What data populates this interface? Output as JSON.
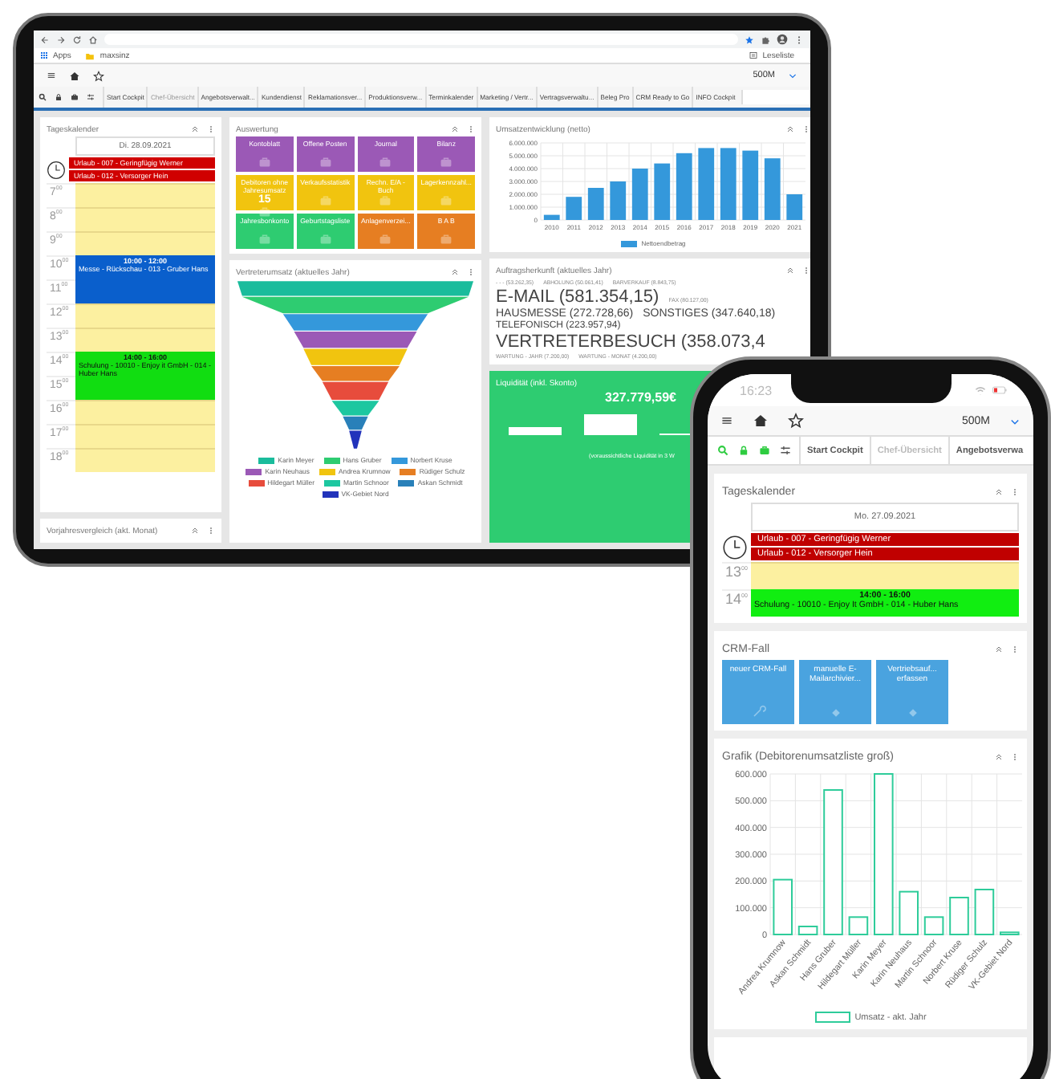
{
  "tablet": {
    "browser": {
      "bookmarks": [
        "Apps",
        "maxsinz"
      ],
      "reading_list": "Leseliste"
    },
    "header": {
      "company": "500M"
    },
    "tabs": [
      {
        "label": "Start Cockpit",
        "disabled": false
      },
      {
        "label": "Chef-Übersicht",
        "disabled": true
      },
      {
        "label": "Angebotsverwalt...",
        "disabled": false
      },
      {
        "label": "Kundendienst",
        "disabled": false
      },
      {
        "label": "Reklamationsver...",
        "disabled": false
      },
      {
        "label": "Produktionsverw...",
        "disabled": false
      },
      {
        "label": "Terminkalender",
        "disabled": false
      },
      {
        "label": "Marketing / Vertr...",
        "disabled": false
      },
      {
        "label": "Vertragsverwaltu...",
        "disabled": false
      },
      {
        "label": "Beleg Pro",
        "disabled": false
      },
      {
        "label": "CRM Ready to Go",
        "disabled": false
      },
      {
        "label": "INFO Cockpit",
        "disabled": false
      }
    ],
    "calendar": {
      "title": "Tageskalender",
      "date": "Di. 28.09.2021",
      "all_day": [
        {
          "title": "Urlaub - 007 - Geringfügig Werner",
          "color": "#d00000"
        },
        {
          "title": "Urlaub - 012 - Versorger Hein",
          "color": "#d00000"
        }
      ],
      "hours": [
        {
          "label": "7$^{00}$",
          "kind": "free"
        },
        {
          "label": "8$^{00}$",
          "kind": "free"
        },
        {
          "label": "9$^{00}$",
          "kind": "free"
        },
        {
          "label": "10$^{00}$",
          "kind": "event",
          "event": {
            "time": "10:00 - 12:00",
            "title": "Messe - Rückschau - 013 - Gruber Hans",
            "color": "#0a5fcc"
          }
        },
        {
          "label": "11$^{00}$",
          "kind": "continued"
        },
        {
          "label": "12$^{00}$",
          "kind": "free"
        },
        {
          "label": "13$^{00}$",
          "kind": "free"
        },
        {
          "label": "14$^{00}$",
          "kind": "event",
          "event": {
            "time": "14:00 - 16:00",
            "title": "Schulung - 10010 - Enjoy it GmbH - 014 - Huber Hans",
            "color": "#11dd11"
          }
        },
        {
          "label": "15$^{00}$",
          "kind": "continued"
        },
        {
          "label": "16$^{00}$",
          "kind": "free"
        },
        {
          "label": "17$^{00}$",
          "kind": "free"
        },
        {
          "label": "18$^{00}$",
          "kind": "free"
        }
      ]
    },
    "comparison": {
      "title": "Vorjahresvergleich (akt. Monat)"
    },
    "evaluation": {
      "title": "Auswertung",
      "tiles": [
        {
          "label": "Kontoblatt",
          "color": "#9b59b6"
        },
        {
          "label": "Offene Posten",
          "color": "#9b59b6"
        },
        {
          "label": "Journal",
          "color": "#9b59b6"
        },
        {
          "label": "Bilanz",
          "color": "#9b59b6"
        },
        {
          "label": "Debitoren ohne Jahresumsatz",
          "color": "#f1c40f",
          "count": "15"
        },
        {
          "label": "Verkaufsstatistik",
          "color": "#f1c40f"
        },
        {
          "label": "Rechn. E/A - Buch",
          "color": "#f1c40f"
        },
        {
          "label": "Lagerkennzahl...",
          "color": "#f1c40f"
        },
        {
          "label": "Jahresbonkonto",
          "color": "#2ecc71"
        },
        {
          "label": "Geburtstagsliste",
          "color": "#2ecc71"
        },
        {
          "label": "Anlagenverzei...",
          "color": "#e67e22"
        },
        {
          "label": "B A B",
          "color": "#e67e22"
        }
      ]
    },
    "sales_funnel": {
      "title": "Vertreterumsatz (aktuelles Jahr)",
      "legend": [
        {
          "name": "Karin Meyer",
          "color": "#1abc9c"
        },
        {
          "name": "Hans Gruber",
          "color": "#2ecc71"
        },
        {
          "name": "Norbert Kruse",
          "color": "#3498db"
        },
        {
          "name": "Karin Neuhaus",
          "color": "#9b59b6"
        },
        {
          "name": "Andrea Krumnow",
          "color": "#f1c40f"
        },
        {
          "name": "Rüdiger Schulz",
          "color": "#e67e22"
        },
        {
          "name": "Hildegart Müller",
          "color": "#e74c3c"
        },
        {
          "name": "Martin Schnoor",
          "color": "#1dc7a0"
        },
        {
          "name": "Askan Schmidt",
          "color": "#2980b9"
        },
        {
          "name": "VK-Gebiet Nord",
          "color": "#2233bb"
        }
      ]
    },
    "revenue": {
      "title": "Umsatzentwicklung (netto)",
      "chart_data": {
        "type": "bar",
        "categories": [
          "2010",
          "2011",
          "2012",
          "2013",
          "2014",
          "2015",
          "2016",
          "2017",
          "2018",
          "2019",
          "2020",
          "2021"
        ],
        "series": [
          {
            "name": "Nettoendbetrag",
            "color": "#3498db",
            "values": [
              400000,
              1800000,
              2500000,
              3000000,
              4000000,
              4400000,
              5200000,
              5600000,
              5600000,
              5400000,
              4800000,
              2000000
            ]
          }
        ],
        "ylim": [
          0,
          6000000
        ],
        "grid": true,
        "yticks": [
          {
            "value": 0,
            "label": "0"
          },
          {
            "value": 1000000,
            "label": "1.000.000"
          },
          {
            "value": 2000000,
            "label": "2.000.000"
          },
          {
            "value": 3000000,
            "label": "3.000.000"
          },
          {
            "value": 4000000,
            "label": "4.000.000"
          },
          {
            "value": 5000000,
            "label": "5.000.000"
          },
          {
            "value": 6000000,
            "label": "6.000.000"
          }
        ]
      }
    },
    "order_origin": {
      "title": "Auftragsherkunft (aktuelles Jahr)",
      "lines": [
        [
          {
            "text": "- - - (53.262,35)",
            "kind": "xs"
          },
          {
            "text": "ABHOLUNG (50.061,41)",
            "kind": "xs"
          },
          {
            "text": "BARVERKAUF (8.843,75)",
            "kind": "xs"
          }
        ],
        [
          {
            "text": "E-MAIL (581.354,15)",
            "kind": "xl"
          },
          {
            "text": "FAX (80.127,00)",
            "kind": "xs"
          }
        ],
        [
          {
            "text": "HAUSMESSE (272.728,66)",
            "kind": "l"
          },
          {
            "text": "SONSTIGES (347.640,18)",
            "kind": "l"
          }
        ],
        [
          {
            "text": "TELEFONISCH (223.957,94)",
            "kind": "m"
          }
        ],
        [
          {
            "text": "VERTRETERBESUCH (358.073,4",
            "kind": "xl"
          }
        ],
        [
          {
            "text": "WARTUNG - JAHR (7.200,00)",
            "kind": "xs"
          },
          {
            "text": "WARTUNG - MONAT (4.200,00)",
            "kind": "xs"
          }
        ]
      ]
    },
    "liquidity": {
      "title": "Liquidität (inkl. Skonto)",
      "amount": "327.779,59€",
      "note": "(voraussichtliche Liquidität in 3 W"
    }
  },
  "phone": {
    "time": "16:23",
    "header": {
      "company": "500M"
    },
    "tabs": [
      {
        "label": "Start Cockpit",
        "disabled": false
      },
      {
        "label": "Chef-Übersicht",
        "disabled": true
      },
      {
        "label": "Angebotsverwa",
        "disabled": false
      }
    ],
    "calendar": {
      "title": "Tageskalender",
      "date": "Mo. 27.09.2021",
      "all_day": [
        {
          "title": "Urlaub - 007 - Geringfügig Werner",
          "color": "#c00000"
        },
        {
          "title": "Urlaub - 012 - Versorger Hein",
          "color": "#c00000"
        }
      ],
      "hours": [
        {
          "label": "13$^{00}$",
          "kind": "free"
        },
        {
          "label": "14$^{00}$",
          "kind": "event",
          "event": {
            "time": "14:00 - 16:00",
            "title": "Schulung - 10010 - Enjoy It GmbH - 014 - Huber Hans",
            "color": "#11ee11"
          }
        }
      ]
    },
    "crm": {
      "title": "CRM-Fall",
      "tiles": [
        {
          "label": "neuer CRM-Fall",
          "kind": "wrench"
        },
        {
          "label": "manuelle E-Mailarchivier...",
          "kind": "diamond"
        },
        {
          "label": "Vertriebsauf... erfassen",
          "kind": "diamond"
        }
      ]
    },
    "chart": {
      "title": "Grafik (Debitorenumsatzliste groß)",
      "chart_data": {
        "type": "bar",
        "categories": [
          "Andrea Krumnow",
          "Askan Schmidt",
          "Hans Gruber",
          "Hildegart Müller",
          "Karin Meyer",
          "Karin Neuhaus",
          "Martin Schnoor",
          "Norbert Kruse",
          "Rüdiger Schulz",
          "VK-Gebiet Nord"
        ],
        "series": [
          {
            "name": "Umsatz - akt. Jahr",
            "color": "#2ecc9a",
            "values": [
              205000,
              30000,
              540000,
              65000,
              600000,
              160000,
              65000,
              138000,
              168000,
              8000
            ]
          }
        ],
        "ylim": [
          0,
          600000
        ],
        "grid": true,
        "yticks": [
          {
            "value": 0,
            "label": "0"
          },
          {
            "value": 100000,
            "label": "100.000"
          },
          {
            "value": 200000,
            "label": "200.000"
          },
          {
            "value": 300000,
            "label": "300.000"
          },
          {
            "value": 400000,
            "label": "400.000"
          },
          {
            "value": 500000,
            "label": "500.000"
          },
          {
            "value": 600000,
            "label": "600.000"
          }
        ]
      }
    }
  }
}
